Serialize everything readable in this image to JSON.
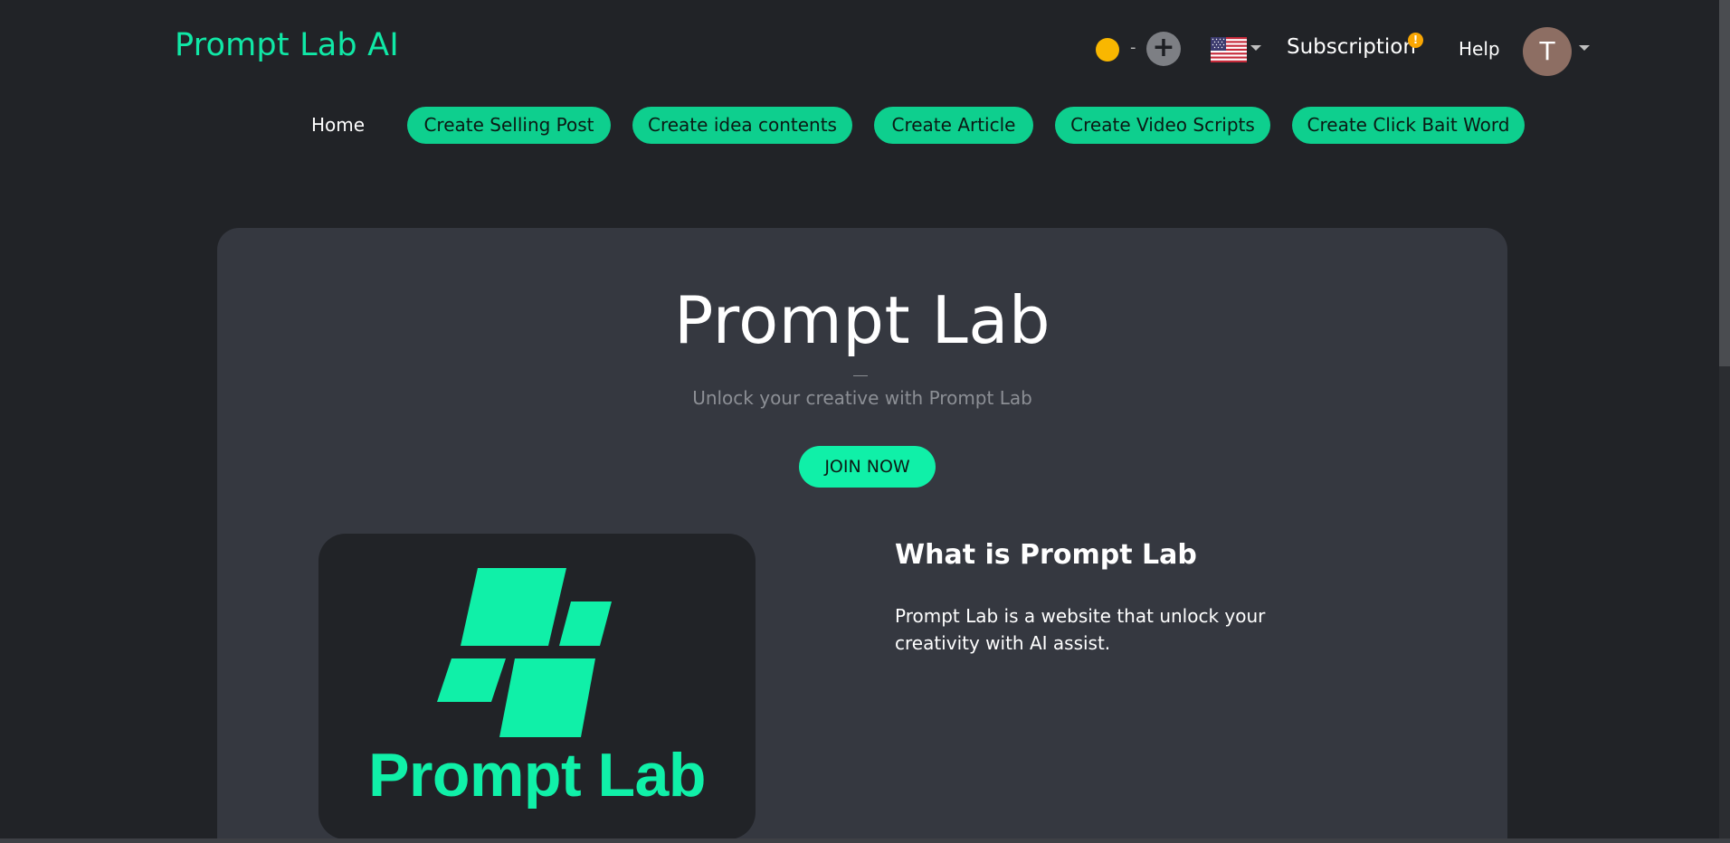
{
  "header": {
    "brand": "Prompt Lab AI",
    "coin_count": "-",
    "add_credits_symbol": "+",
    "language": "US flag",
    "subscription_label": "Subscription",
    "subscription_badge": "!",
    "help_label": "Help",
    "avatar_initial": "T"
  },
  "nav": {
    "home": "Home",
    "pills": [
      "Create Selling Post",
      "Create idea contents",
      "Create Article",
      "Create Video Scripts",
      "Create Click Bait Word"
    ]
  },
  "hero": {
    "title": "Prompt Lab",
    "subtitle": "Unlock your creative with Prompt Lab",
    "cta": "JOIN NOW"
  },
  "about": {
    "logo_text": "Prompt Lab",
    "title": "What is Prompt Lab",
    "body": "Prompt Lab is a website that unlock your creativity with AI assist."
  },
  "colors": {
    "background": "#212327",
    "card": "#353840",
    "accent": "#10f0a8",
    "pill": "#0ecf8e",
    "coin": "#f9b700",
    "avatar": "#8d6e63"
  },
  "icons": [
    "coin-icon",
    "plus-icon",
    "us-flag-icon",
    "chevron-down-icon",
    "warning-badge-icon",
    "prompt-lab-logo"
  ]
}
